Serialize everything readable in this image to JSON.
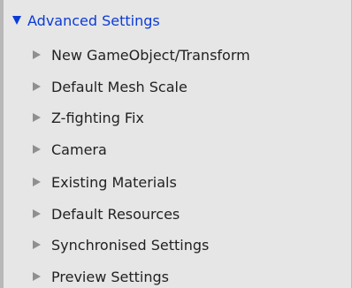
{
  "header": {
    "title": "Advanced Settings",
    "icon": "triangle-down-icon",
    "color": "#0b3bd6"
  },
  "items": [
    {
      "label": "New GameObject/Transform",
      "icon": "triangle-right-icon"
    },
    {
      "label": "Default Mesh Scale",
      "icon": "triangle-right-icon"
    },
    {
      "label": "Z-fighting Fix",
      "icon": "triangle-right-icon"
    },
    {
      "label": "Camera",
      "icon": "triangle-right-icon"
    },
    {
      "label": "Existing Materials",
      "icon": "triangle-right-icon"
    },
    {
      "label": "Default Resources",
      "icon": "triangle-right-icon"
    },
    {
      "label": "Synchronised Settings",
      "icon": "triangle-right-icon"
    },
    {
      "label": "Preview Settings",
      "icon": "triangle-right-icon"
    }
  ],
  "colors": {
    "panel_background": "#e6e6e6",
    "text": "#222222",
    "arrow": "#8f8f8f"
  }
}
